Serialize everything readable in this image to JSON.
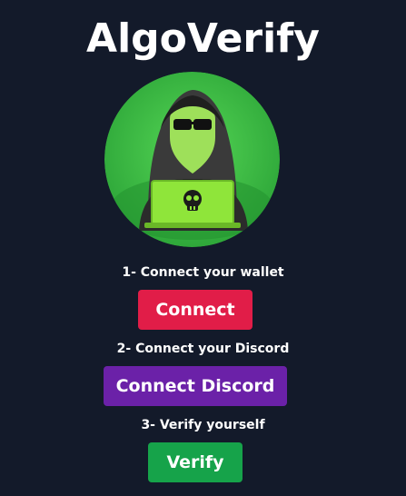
{
  "app": {
    "title": "AlgoVerify"
  },
  "steps": [
    {
      "label": "1- Connect your wallet",
      "button": "Connect"
    },
    {
      "label": "2- Connect your Discord",
      "button": "Connect Discord"
    },
    {
      "label": "3- Verify yourself",
      "button": "Verify"
    }
  ],
  "colors": {
    "background": "#131a2a",
    "connect": "#e11d48",
    "discord": "#6b21a8",
    "verify": "#16a34a",
    "avatar_green": "#3cc13c",
    "laptop_green": "#8fe53a"
  },
  "icons": {
    "avatar": "hooded-hacker-laptop-icon",
    "laptop_logo": "skull-icon"
  }
}
